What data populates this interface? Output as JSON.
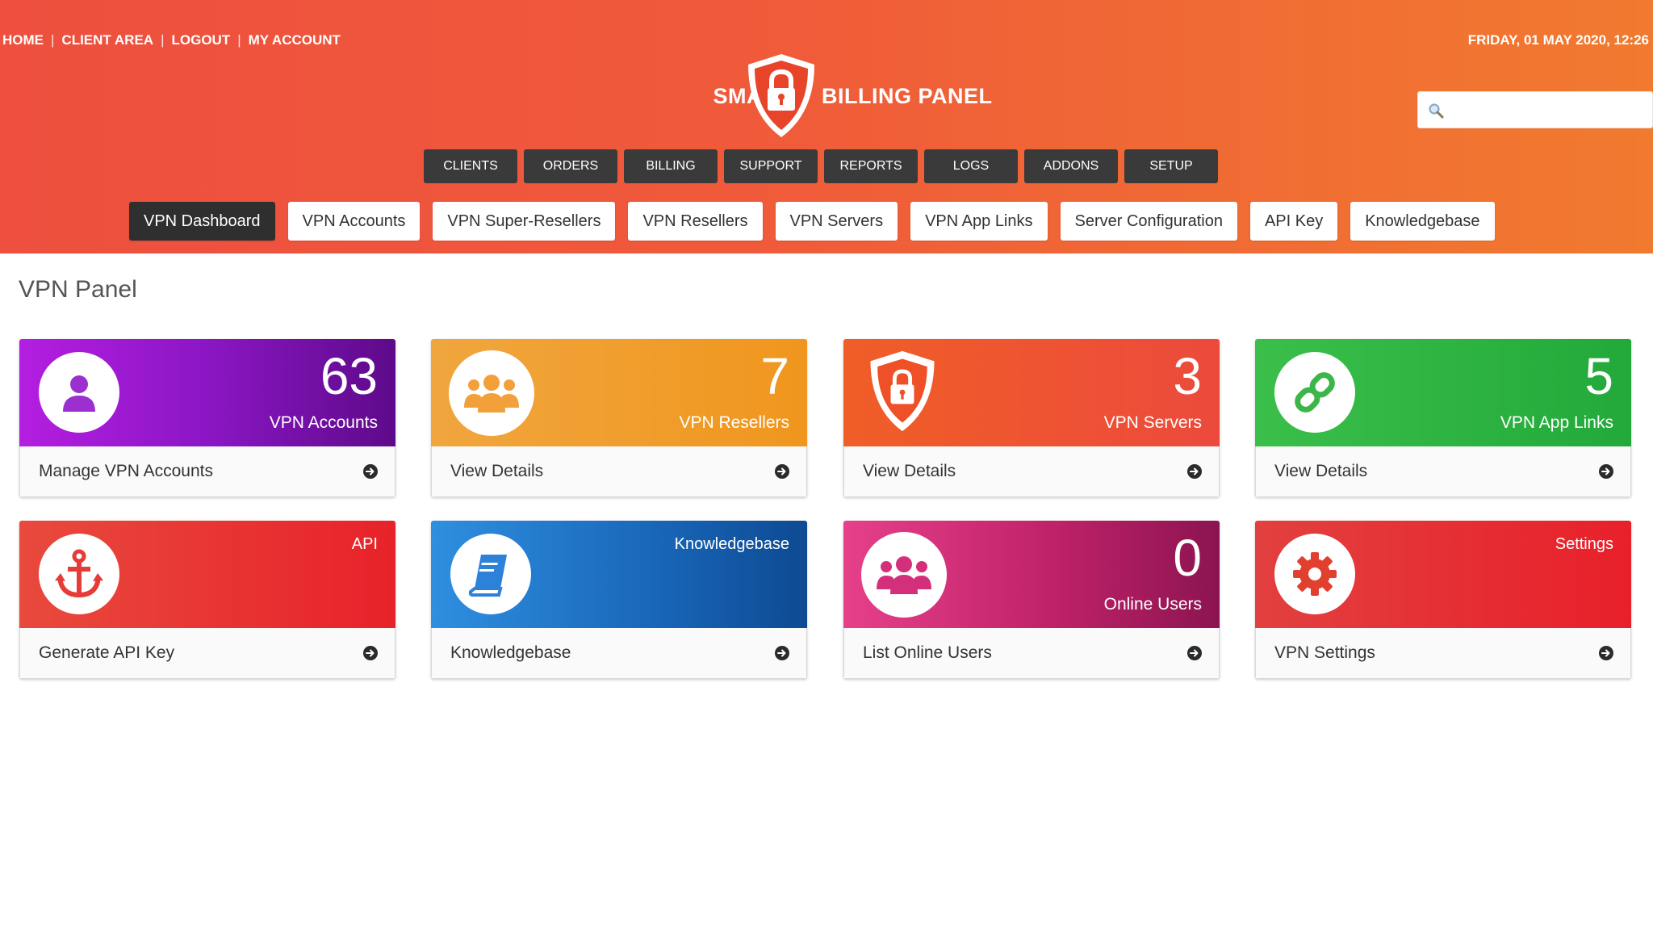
{
  "top_links": [
    "HOME",
    "CLIENT AREA",
    "LOGOUT",
    "MY ACCOUNT"
  ],
  "datetime": "FRIDAY, 01 MAY 2020, 12:26",
  "logo": {
    "left": "SMART",
    "right": "BILLING PANEL"
  },
  "search": {
    "placeholder": ""
  },
  "main_nav": [
    "CLIENTS",
    "ORDERS",
    "BILLING",
    "SUPPORT",
    "REPORTS",
    "LOGS",
    "ADDONS",
    "SETUP"
  ],
  "sub_nav": [
    "VPN Dashboard",
    "VPN Accounts",
    "VPN Super-Resellers",
    "VPN Resellers",
    "VPN Servers",
    "VPN App Links",
    "Server Configuration",
    "API Key",
    "Knowledgebase"
  ],
  "page_title": "VPN Panel",
  "cards": [
    {
      "number": "63",
      "label": "VPN Accounts",
      "footer": "Manage VPN Accounts",
      "icon": "user-icon",
      "color": "#8b16c4"
    },
    {
      "number": "7",
      "label": "VPN Resellers",
      "footer": "View Details",
      "icon": "users-icon",
      "color": "#f0961e"
    },
    {
      "number": "3",
      "label": "VPN Servers",
      "footer": "View Details",
      "icon": "shield-lock-icon",
      "color": "#ec4a3c"
    },
    {
      "number": "5",
      "label": "VPN App Links",
      "footer": "View Details",
      "icon": "link-icon",
      "color": "#22a93a"
    },
    {
      "label": "API",
      "footer": "Generate API Key",
      "icon": "anchor-icon",
      "color": "#e8222a"
    },
    {
      "label": "Knowledgebase",
      "footer": "Knowledgebase",
      "icon": "book-icon",
      "color": "#1966b8"
    },
    {
      "number": "0",
      "label": "Online Users",
      "footer": "List Online Users",
      "icon": "users-icon",
      "color": "#c0226a"
    },
    {
      "label": "Settings",
      "footer": "VPN Settings",
      "icon": "gear-icon",
      "color": "#e8202a"
    }
  ]
}
